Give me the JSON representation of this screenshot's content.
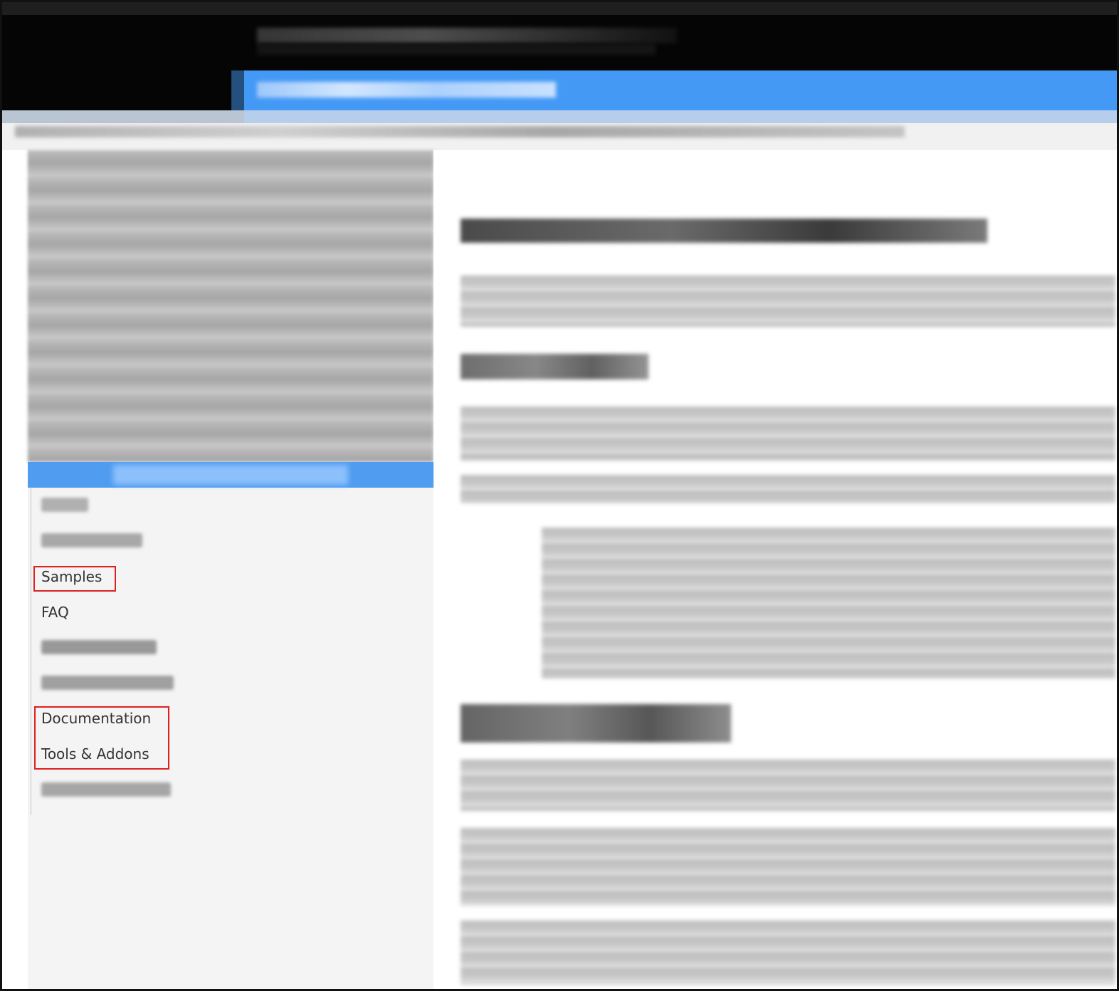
{
  "nav": {
    "items": [
      {
        "label": "Samples"
      },
      {
        "label": "FAQ"
      },
      {
        "label": "Documentation"
      },
      {
        "label": "Tools & Addons"
      }
    ]
  },
  "colors": {
    "header_bg": "#050505",
    "accent_blue": "#4499f5",
    "sidebar_bg": "#f4f4f4",
    "highlight_box": "#e02020"
  }
}
